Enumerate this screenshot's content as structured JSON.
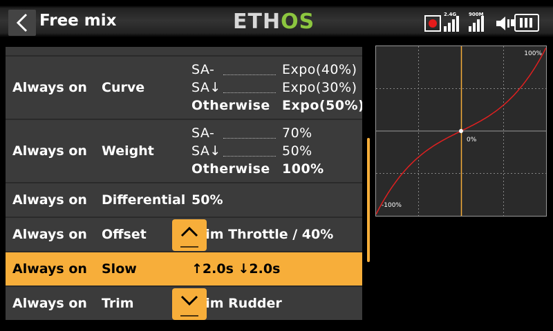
{
  "header": {
    "title": "Free mix",
    "logo_left": "ETH",
    "logo_right": "OS",
    "rf_label": "2.4G",
    "telemetry_label": "900M",
    "icons": [
      "back-icon",
      "record-icon",
      "rf-signal-icon",
      "telemetry-signal-icon",
      "speaker-icon",
      "battery-icon"
    ]
  },
  "rows": [
    {
      "condition": "Always on",
      "param": "Curve",
      "entries": [
        {
          "key": "SA-",
          "value": "Expo(40%)"
        },
        {
          "key": "SA↓",
          "value": "Expo(30%)"
        },
        {
          "key": "Otherwise",
          "value": "Expo(50%)"
        }
      ]
    },
    {
      "condition": "Always on",
      "param": "Weight",
      "entries": [
        {
          "key": "SA-",
          "value": "70%"
        },
        {
          "key": "SA↓",
          "value": "50%"
        },
        {
          "key": "Otherwise",
          "value": "100%"
        }
      ]
    },
    {
      "condition": "Always on",
      "param": "Differential",
      "value": "50%"
    },
    {
      "condition": "Always on",
      "param": "Offset",
      "value": "Trim Throttle / 40%"
    },
    {
      "condition": "Always on",
      "param": "Slow",
      "value": "↑2.0s ↓2.0s",
      "selected": true
    },
    {
      "condition": "Always on",
      "param": "Trim",
      "value": "Trim Rudder"
    }
  ],
  "curve": {
    "top_label": "100%",
    "center_label": "0%",
    "bottom_label": "-100%",
    "curve_color": "#e02020",
    "cursor_color": "#f7ae3a"
  },
  "colors": {
    "accent": "#f7ae3a",
    "row_bg": "#3b3b3b",
    "logo_green": "#8cc63f"
  }
}
